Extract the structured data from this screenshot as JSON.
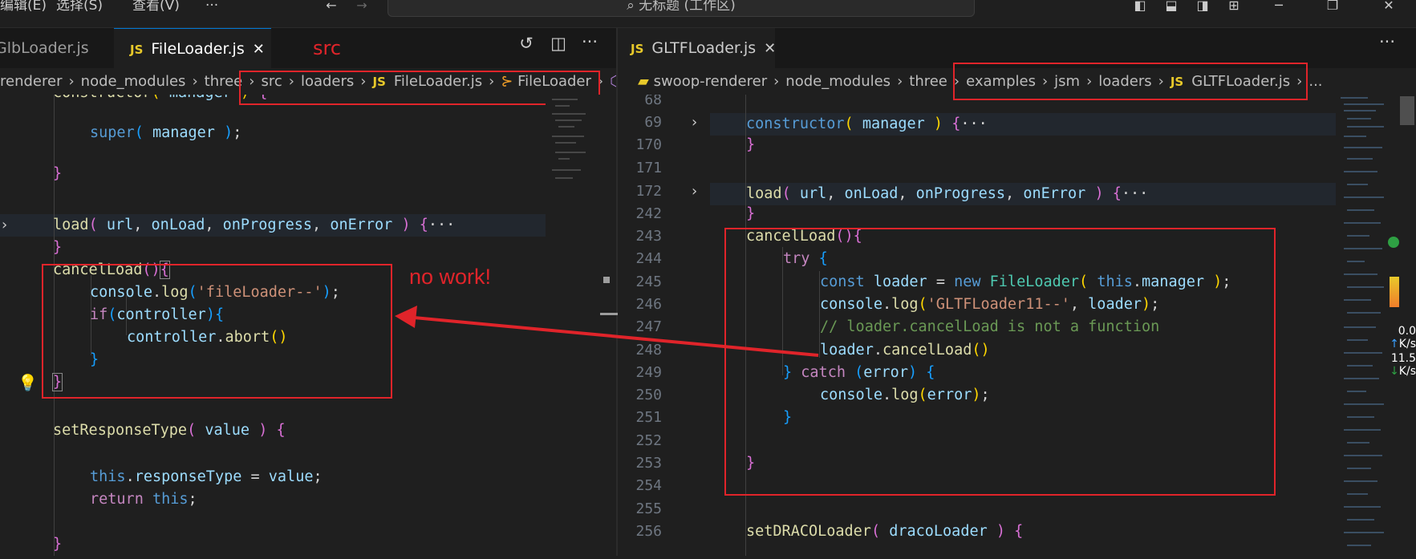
{
  "menu": {
    "edit": "编辑(E)",
    "select": "选择(S)",
    "view": "查看(V)",
    "more": "···"
  },
  "command_center": {
    "text": "无标题 (工作区)"
  },
  "left": {
    "tabs": [
      {
        "label": "GlbLoader.js"
      },
      {
        "label": "FileLoader.js",
        "icon": "JS",
        "active": true
      }
    ],
    "tab_annotation": "src",
    "breadcrumb": [
      "renderer",
      "node_modules",
      "three",
      "src",
      "loaders",
      "FileLoader.js",
      "FileLoader"
    ],
    "annotation": "no work!"
  },
  "right": {
    "tabs": [
      {
        "label": "GLTFLoader.js",
        "icon": "JS"
      }
    ],
    "breadcrumb": [
      "swoop-renderer",
      "node_modules",
      "three",
      "examples",
      "jsm",
      "loaders",
      "GLTFLoader.js",
      "..."
    ],
    "line_numbers": [
      "68",
      "69",
      "170",
      "171",
      "172",
      "242",
      "243",
      "244",
      "245",
      "246",
      "247",
      "248",
      "249",
      "250",
      "251",
      "252",
      "253",
      "254",
      "255",
      "256"
    ]
  },
  "net_speed": {
    "up": "0.0",
    "up_unit": "K/s",
    "down": "11.5",
    "down_unit": "K/s"
  },
  "colors": {
    "accent": "#0078d4",
    "annotation_red": "#e0242a",
    "background": "#1f1f1f"
  }
}
